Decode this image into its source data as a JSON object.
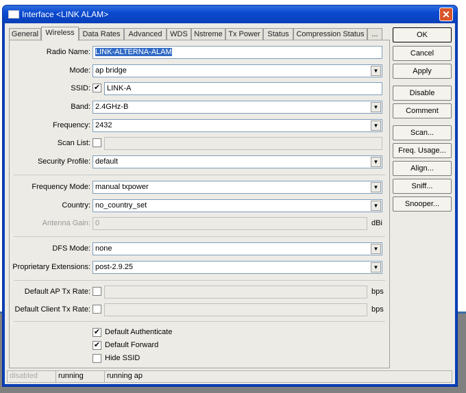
{
  "window": {
    "title": "Interface <LINK ALAM>",
    "close": "✕"
  },
  "tabs": [
    "General",
    "Wireless",
    "Data Rates",
    "Advanced",
    "WDS",
    "Nstreme",
    "Tx Power",
    "Status",
    "Compression Status",
    "..."
  ],
  "fields": {
    "radio_name": {
      "label": "Radio Name:",
      "value": "LINK-ALTERNA-ALAM"
    },
    "mode": {
      "label": "Mode:",
      "value": "ap bridge"
    },
    "ssid": {
      "label": "SSID:",
      "value": "LINK-A",
      "checked": true
    },
    "band": {
      "label": "Band:",
      "value": "2.4GHz-B"
    },
    "frequency": {
      "label": "Frequency:",
      "value": "2432"
    },
    "scan_list": {
      "label": "Scan List:",
      "value": ""
    },
    "security_profile": {
      "label": "Security Profile:",
      "value": "default"
    },
    "frequency_mode": {
      "label": "Frequency Mode:",
      "value": "manual txpower"
    },
    "country": {
      "label": "Country:",
      "value": "no_country_set"
    },
    "antenna_gain": {
      "label": "Antenna Gain:",
      "value": "0",
      "unit": "dBi"
    },
    "dfs_mode": {
      "label": "DFS Mode:",
      "value": "none"
    },
    "proprietary": {
      "label": "Proprietary Extensions:",
      "value": "post-2.9.25"
    },
    "ap_tx_rate": {
      "label": "Default AP Tx Rate:",
      "value": "",
      "unit": "bps"
    },
    "client_tx_rate": {
      "label": "Default Client Tx Rate:",
      "value": "",
      "unit": "bps"
    }
  },
  "checkboxes": [
    {
      "label": "Default Authenticate",
      "checked": true
    },
    {
      "label": "Default Forward",
      "checked": true
    },
    {
      "label": "Hide SSID",
      "checked": false
    }
  ],
  "check_mark": "✔",
  "dropdown_glyph": "▼",
  "buttons": [
    "OK",
    "Cancel",
    "Apply",
    "Disable",
    "Comment",
    "Scan...",
    "Freq. Usage...",
    "Align...",
    "Sniff...",
    "Snooper..."
  ],
  "status": [
    "disabled",
    "running",
    "running ap"
  ]
}
